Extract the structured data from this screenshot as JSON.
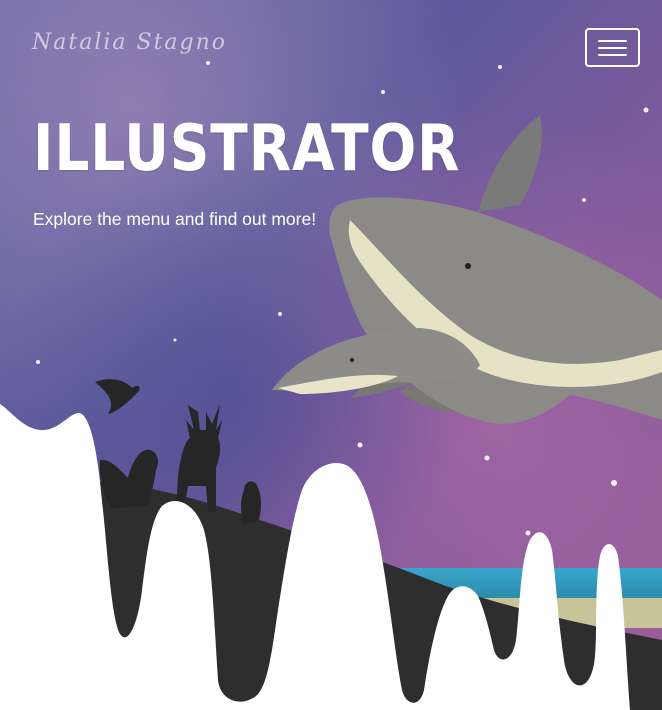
{
  "header": {
    "brand_name": "Natalia Stagno",
    "menu_icon": "hamburger-menu-icon"
  },
  "hero": {
    "title": "ILLUSTRATOR",
    "subtitle": "Explore the menu and find out more!"
  },
  "colors": {
    "sky_deep": "#4a4a8a",
    "sky_purple": "#8a5a9a",
    "sky_magenta": "#a06aa8",
    "ground": "#2e2e2e",
    "sea": "#3aa0c8",
    "whale_body": "#8c8c8c",
    "whale_belly": "#e8e4c8",
    "text": "#ffffff"
  }
}
